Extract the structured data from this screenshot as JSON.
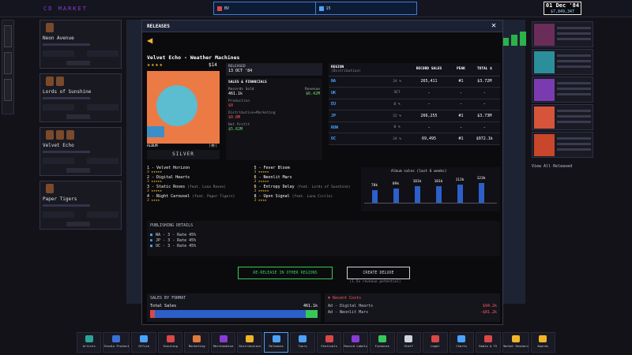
{
  "topbar": {
    "title": "CD MARKET"
  },
  "ticker": {
    "left_text": "BV",
    "left_value": "",
    "right_text": "15",
    "right_value": ""
  },
  "date": {
    "date": "01 Dec '84",
    "money": "$7,849,347"
  },
  "left_cards": [
    {
      "name": "Neon Avenue"
    },
    {
      "name": "Lords of Sunshine"
    },
    {
      "name": "Velvet Echo"
    },
    {
      "name": "Paper Tigers"
    }
  ],
  "right_cards_footer": "View All Released",
  "modal": {
    "title": "RELEASES",
    "close": "✕",
    "release_title": "Velvet Echo - Weather Machines",
    "stars": "★★★★",
    "price": "$14",
    "album_label": "ALBUM",
    "view_label": "[👁]",
    "certification": "SILVER",
    "release_head": "RELEASED",
    "release_date": "13 OCT '84",
    "sales_head": "SALES & FINANCIALS",
    "records_sold_label": "Records Sold",
    "records_sold": "461.1k",
    "revenue_label": "Revenue",
    "revenue": "$6.42M",
    "production_label": "Production",
    "production": "$0",
    "dist_label": "Distribution+Marketing",
    "dist": "$0.8M",
    "net_profit_label": "Net Profit",
    "net_profit": "$5.62M"
  },
  "region_table": {
    "headers": [
      "REGION",
      "RECORD SALES",
      "PEAK",
      "TOTAL $"
    ],
    "sub_header": "(Distribution)",
    "rows": [
      {
        "region": "NA",
        "pct": "34 %",
        "sales": "265,411",
        "peak": "#1",
        "total": "$3.72M"
      },
      {
        "region": "UK",
        "pct": "SET",
        "sales": "-",
        "peak": "-",
        "total": "-"
      },
      {
        "region": "EU",
        "pct": "0 %",
        "sales": "-",
        "peak": "-",
        "total": "-"
      },
      {
        "region": "JP",
        "pct": "32 %",
        "sales": "266,255",
        "peak": "#1",
        "total": "$3.73M"
      },
      {
        "region": "ROW",
        "pct": "0 %",
        "sales": "-",
        "peak": "-",
        "total": "-"
      },
      {
        "region": "OC",
        "pct": "34 %",
        "sales": "69,495",
        "peak": "#1",
        "total": "$972.1k"
      }
    ]
  },
  "tracks": [
    {
      "name": "1 - Velvet Horizon",
      "feat": "",
      "stars": "3 ★★★★★"
    },
    {
      "name": "5 - Fever Bloom",
      "feat": "",
      "stars": "3 ★★★★★"
    },
    {
      "name": "2 - Digital Hearts",
      "feat": "",
      "stars": "3 ★★★★★"
    },
    {
      "name": "6 - Neonlit Mars",
      "feat": "",
      "stars": "3 ★★★★★"
    },
    {
      "name": "3 - Static Roses",
      "feat": "(feat. Luna Raven)",
      "stars": "3 ★★★★★"
    },
    {
      "name": "6 - Entropy Delay",
      "feat": "(feat. Lords of Sunshine)",
      "stars": "3 ★★★★★"
    },
    {
      "name": "4 - Night Carousel",
      "feat": "(feat. Paper Tigers)",
      "stars": "3 ★★★★"
    },
    {
      "name": "8 - Upon Signal",
      "feat": "(feat. Luna Circle)",
      "stars": "3 ★★★★"
    }
  ],
  "chart_data": {
    "type": "bar",
    "title": "Album sales (last 6 weeks)",
    "categories": [
      "w1",
      "w2",
      "w3",
      "w4",
      "w5",
      "w6"
    ],
    "labels": [
      "78k",
      "89k",
      "101k",
      "101k",
      "112k",
      "123k"
    ],
    "values": [
      78,
      89,
      101,
      101,
      112,
      123
    ],
    "ylim": [
      0,
      140
    ]
  },
  "publishing": {
    "head": "PUBLISHING DETAILS",
    "rows": [
      {
        "flag": "■",
        "text": "NA - 3 - Rate 45%"
      },
      {
        "flag": "●",
        "text": "JP - 3 - Rate 45%"
      },
      {
        "flag": "■",
        "text": "OC - 3 - Rate 45%"
      }
    ]
  },
  "actions": {
    "rerelease": "RE-RELEASE IN OTHER REGIONS",
    "deluxe": "CREATE DELUXE",
    "deluxe_sub": "(1.5x revenue potential)"
  },
  "sales_by_format": {
    "head": "SALES BY FORMAT",
    "total_label": "Total Sales",
    "total_value": "461.1k",
    "segments": [
      {
        "share": 0.03,
        "color": "#d84848"
      },
      {
        "share": 0.9,
        "color": "#2c5fc9"
      },
      {
        "share": 0.07,
        "color": "#36c95a"
      }
    ]
  },
  "costs": {
    "head": "▼ Recent Costs",
    "rows": [
      {
        "label": "Ad - Digital Hearts",
        "value": "$94.2k"
      },
      {
        "label": "Ad - Neonlit Mars",
        "value": "-$81.2k"
      }
    ]
  },
  "dock": [
    {
      "label": "Artists",
      "color": "#2aa39a"
    },
    {
      "label": "Studio Production",
      "color": "#3b6fd6"
    },
    {
      "label": "Office",
      "color": "#4aa3ff"
    },
    {
      "label": "Scouting",
      "color": "#d84848"
    },
    {
      "label": "Marketing",
      "color": "#e07a3a"
    },
    {
      "label": "Merchandise",
      "color": "#8a3bd6"
    },
    {
      "label": "Distribution",
      "color": "#f0b429"
    },
    {
      "label": "Releases",
      "color": "#4aa3ff"
    },
    {
      "label": "Tours",
      "color": "#4aa3ff"
    },
    {
      "label": "Festivals",
      "color": "#d84848"
    },
    {
      "label": "Record Labels",
      "color": "#8a3bd6"
    },
    {
      "label": "Finances",
      "color": "#36c95a"
    },
    {
      "label": "Staff",
      "color": "#cfd3dc"
    },
    {
      "label": "Legal",
      "color": "#d84848"
    },
    {
      "label": "Charts",
      "color": "#4aa3ff"
    },
    {
      "label": "Radio & TV",
      "color": "#d84848"
    },
    {
      "label": "Market Research",
      "color": "#f0b429"
    },
    {
      "label": "Awards",
      "color": "#f0b429"
    }
  ]
}
